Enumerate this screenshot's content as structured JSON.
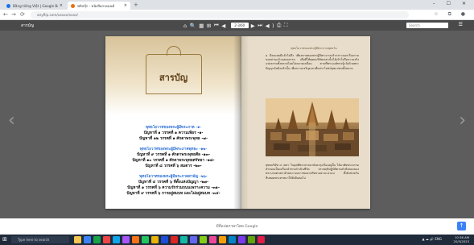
{
  "browser": {
    "tabs": [
      {
        "title": "Bằng tiếng Việt | Google Books"
      },
      {
        "title": "ฟลิปบุ๊ก - หนังสือสวดมนต์"
      }
    ],
    "new_tab": "+",
    "window_controls": "– ☐ ✕",
    "back": "←",
    "forward": "→",
    "reload": "⟳",
    "home": "⌂",
    "address": "anyflip.com/xxxxx/xxxx/",
    "toolbar_icons": "☆ ⧉ ●"
  },
  "viewer": {
    "title": "สารบัญ",
    "tools": {
      "home": "⌂",
      "zoom": "🔍",
      "grid": "▦",
      "share": "⊞",
      "first": "⏮",
      "prev": "◀",
      "page_indicator": "2-3/60",
      "next": "▶",
      "last": "⏭",
      "sound": "◀)",
      "print": "⎙",
      "fullscreen": "⛶"
    },
    "search_placeholder": "Search",
    "menu_icon": "☰",
    "prev_arrow": "‹",
    "next_arrow": "›"
  },
  "left_page": {
    "title": "สารบัญ",
    "sections": [
      {
        "heading": "พุทธโอวาทของพระผู้มีพระภาค -๑-",
        "items": [
          "ปัญหาที่ ๑ วรรคที่ ๑ ความเพียร -๑-",
          "ปัญหาที่ ๑๒ วรรคที่ ๑ ศักดาพระพุทธ -๗-"
        ]
      },
      {
        "heading": "พุทธโอวาทของพระผู้มีพระภาคพุทธะ -๑๒-",
        "items": [
          "ปัญหาที่ ๙ วรรคที่ ๑ ศักดาพระพุทธศีล -๑๓-",
          "ปัญหาที่ ๑๐ วรรคที่ ๑ ศักดาพระพุทธศรัทธา -๑๘-",
          "ปัญหาที่ ๘ วรรคที่ ๖ สมดาร -๒๓-"
        ]
      },
      {
        "heading": "พุทธโอวาทของพระผู้มีพระภาคสามัญ -๒๖-",
        "items": [
          "ปัญหาที่ ๔ วรรคที่ ๖ ที่ตั้งแห่งปัญญา -๒๗-",
          "ปัญหาที่ ๑ วรรคที่ ๖ ความรักร่วมถนนเพราะความ -๓๑-",
          "ปัญหาที่ ๙ วรรคที่ ๖ การอยู่สมบท และไม่อยู่สมบท -๓๔-"
        ]
      }
    ]
  },
  "right_page": {
    "caption": "พุทธโอวาทของพระผู้มีพระภาคพุทธวัน",
    "paragraph1": "๑ มีคนเคยมีแล้วไม่ถึง เพียงชายของพระผู้มีพระภาคเจ้ากล่าวนอกเรื่องถามของท่านแล้วแสดงธรรม เพื่อที่ให้พุทธบริษัทเหล่านั้นได้เข้าใจถึงความจริงแห่งธรรมทั้งหลายโดยไม่คลาดเคลื่อน ตามที่พระองค์ทรงรู้แจ้งด้วยพระปัญญาอันยิ่งแล้วนั้น เพื่อความเจริญและเพื่อประโยชน์สุขแก่ชนทั้งหลาย",
    "paragraph2": "พุทธบริษัท ๔ เหล่า ในยุคที่พระศาสนายังคงรุ่งเรืองอยู่นั้น ได้อาศัยพระธรรมคำสอนเป็นเครื่องนำทางดำเนินชีวิต ประพฤติปฏิบัติตามคำสั่งสอนของพระบรมศาสดาด้วยความเคารพและศรัทธาอย่างแน่วแน่ ทั้งยังช่วยกันสืบทอดพระศาสนาให้ยั่งยืนต่อไป"
  },
  "footer": {
    "translate_text": "มีที่แปลภาษาโดย Google",
    "fab": "↑"
  },
  "taskbar": {
    "start": "⊞",
    "search_placeholder": "Type here to search",
    "tray_icons": "▲ ☁ 🔊 ENG",
    "time": "10:36 AM",
    "date": "20/3/2023",
    "app_colors": [
      "#f3c64f",
      "#3b82f6",
      "#16a34a",
      "#ef4444",
      "#0ea5e9",
      "#a855f7",
      "#f97316",
      "#22c55e",
      "#eab308",
      "#1d4ed8",
      "#dc2626",
      "#14b8a6",
      "#6366f1",
      "#84cc16",
      "#ec4899",
      "#f59e0b",
      "#0284c7",
      "#7c3aed",
      "#65a30d",
      "#e11d48"
    ]
  }
}
